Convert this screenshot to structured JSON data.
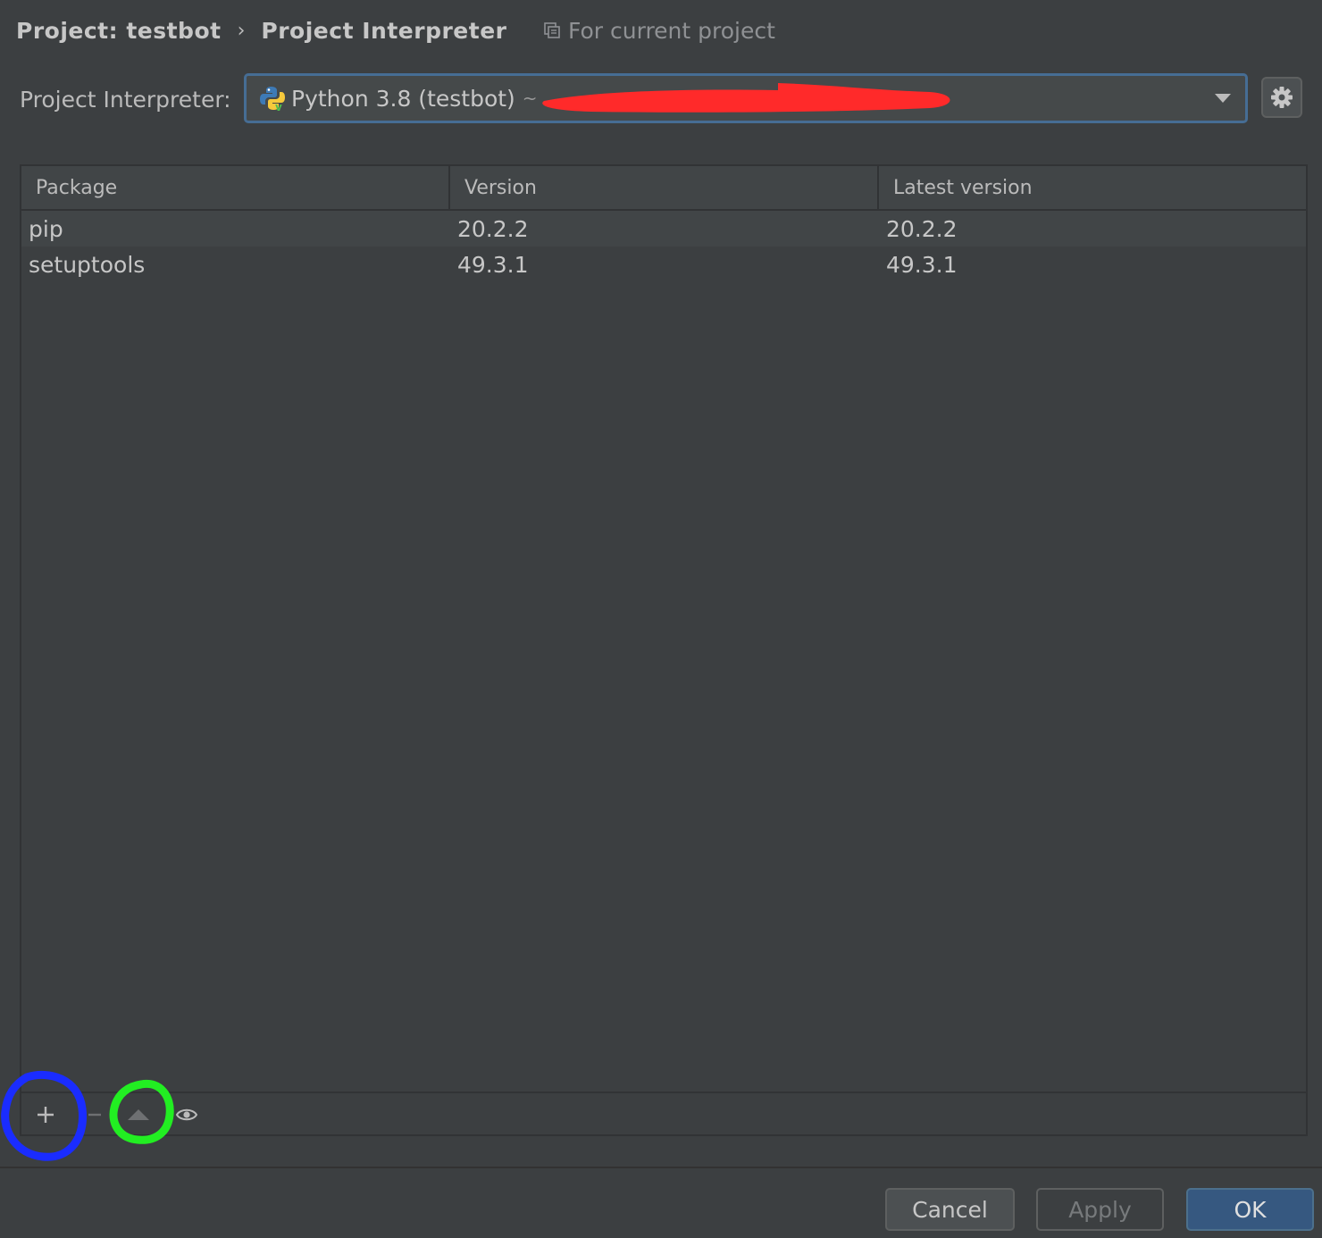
{
  "breadcrumb": {
    "project": "Project: testbot",
    "separator": "›",
    "page": "Project Interpreter"
  },
  "scope_label": "For current project",
  "interpreter": {
    "label": "Project Interpreter:",
    "value": "Python 3.8 (testbot)",
    "path_prefix": "~"
  },
  "table": {
    "columns": [
      "Package",
      "Version",
      "Latest version"
    ],
    "rows": [
      {
        "package": "pip",
        "version": "20.2.2",
        "latest": "20.2.2"
      },
      {
        "package": "setuptools",
        "version": "49.3.1",
        "latest": "49.3.1"
      }
    ]
  },
  "toolbar": {
    "icons": [
      "plus-icon",
      "minus-icon",
      "upgrade-icon",
      "eye-icon"
    ]
  },
  "buttons": {
    "cancel": "Cancel",
    "apply": "Apply",
    "ok": "OK"
  },
  "colors": {
    "background": "#3c3f41",
    "accent": "#365880",
    "focus_border": "#466d94",
    "annotation_red": "#ff2a2a",
    "annotation_blue": "#1a2cff",
    "annotation_green": "#22ee22"
  }
}
